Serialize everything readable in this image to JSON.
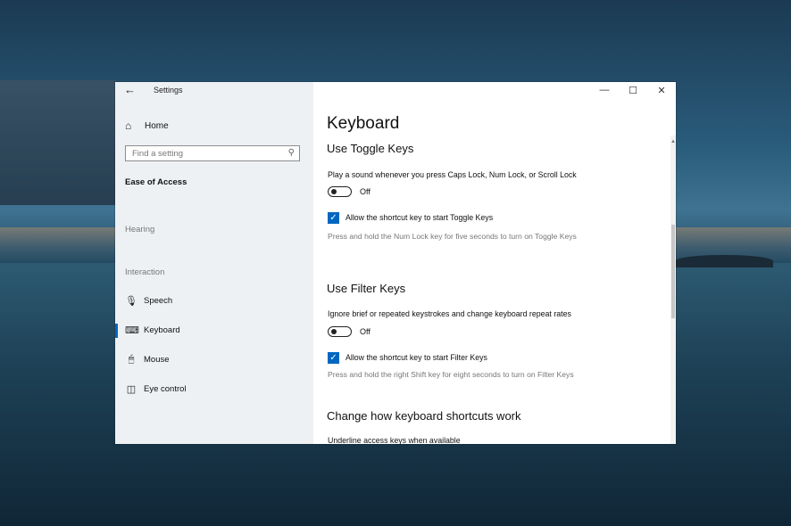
{
  "window": {
    "title": "Settings",
    "controls": {
      "minimize": "—",
      "maximize": "☐",
      "close": "✕"
    }
  },
  "sidebar": {
    "home_label": "Home",
    "search_placeholder": "Find a setting",
    "section_title": "Ease of Access",
    "groups": {
      "hearing": "Hearing",
      "interaction": "Interaction"
    },
    "items": [
      {
        "label": "Speech",
        "icon": "microphone-icon"
      },
      {
        "label": "Keyboard",
        "icon": "keyboard-icon",
        "selected": true
      },
      {
        "label": "Mouse",
        "icon": "mouse-icon"
      },
      {
        "label": "Eye control",
        "icon": "eye-control-icon"
      }
    ]
  },
  "main": {
    "page_title": "Keyboard",
    "toggle_keys": {
      "heading": "Use Toggle Keys",
      "description": "Play a sound whenever you press Caps Lock, Num Lock, or Scroll Lock",
      "toggle_state": "Off",
      "checkbox_label": "Allow the shortcut key to start Toggle Keys",
      "hint": "Press and hold the Num Lock key for five seconds to turn on Toggle Keys"
    },
    "filter_keys": {
      "heading": "Use Filter Keys",
      "description": "Ignore brief or repeated keystrokes and change keyboard repeat rates",
      "toggle_state": "Off",
      "checkbox_label": "Allow the shortcut key to start Filter Keys",
      "hint": "Press and hold the right Shift key for eight seconds to turn on Filter Keys"
    },
    "shortcuts": {
      "heading": "Change how keyboard shortcuts work",
      "description": "Underline access keys when available"
    }
  },
  "colors": {
    "accent": "#0067c0",
    "sidebar_bg": "#eef1f4"
  }
}
